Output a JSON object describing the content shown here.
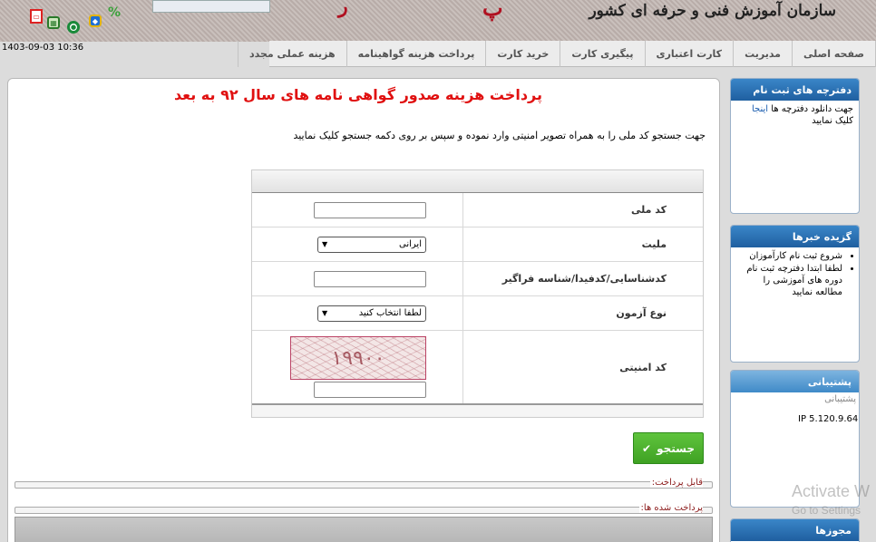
{
  "header": {
    "org_title": "سازمان آموزش فنی و حرفه ای کشور",
    "datetime": "1403-09-03 10:36",
    "icons": [
      "pdf-icon",
      "calculator-icon",
      "green-circle-icon",
      "hexagon-icon",
      "percent-icon"
    ]
  },
  "nav": {
    "items": [
      "صفحه اصلی",
      "مدیریت",
      "کارت اعتباری",
      "پیگیری کارت",
      "خرید کارت",
      "پرداخت هزینه گواهینامه",
      "هزینه عملی مجدد"
    ]
  },
  "main": {
    "title": "پرداخت هزینه صدور گواهی نامه های سال ۹۲ به بعد",
    "instructions": "جهت جستجو کد ملی را به همراه تصویر امنیتی وارد نموده و سپس بر روی دکمه جستجو کلیک نمایید",
    "form": {
      "national_code_label": "کد ملی",
      "national_code_value": "",
      "nationality_label": "ملیت",
      "nationality_selected": "ایرانی",
      "id_label": "کدشناسایی/کدفیدا/شناسه فراگیر",
      "id_value": "",
      "exam_type_label": "نوع آزمون",
      "exam_type_selected": "لطفا انتخاب کنید",
      "captcha_label": "کد امنیتی",
      "captcha_text": "۱۹۹۰۰",
      "captcha_value": ""
    },
    "search_button": "جستجو",
    "payable_label": "قابل پرداخت:",
    "paid_label": "پرداخت شده ها:"
  },
  "sidebar": {
    "registration": {
      "title": "دفترچه های ثبت نام",
      "text_before": "جهت دانلود دفترچه ها",
      "link": "اینجا",
      "text_after": "کلیک نمایید"
    },
    "news": {
      "title": "گزیده خبرها",
      "items": [
        "شروع ثبت نام کارآموزان",
        "لطفا ابتدا دفترچه ثبت نام دوره های آموزشی را مطالعه نمایید"
      ]
    },
    "support": {
      "title": "پشتیبانی",
      "subtitle": "پشتیبانی",
      "ip": "IP 5.120.9.64"
    },
    "licenses": {
      "title": "مجوزها"
    }
  },
  "watermark": {
    "title": "Activate W",
    "subtitle": "Go to Settings"
  }
}
